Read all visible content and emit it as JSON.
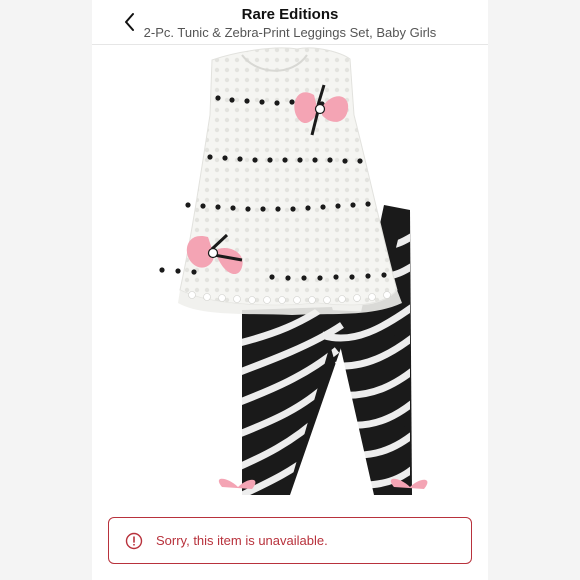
{
  "header": {
    "title": "Rare Editions",
    "subtitle": "2-Pc. Tunic & Zebra-Print Leggings Set, Baby Girls",
    "back_icon": "chevron-left-icon"
  },
  "product": {
    "image": "product-photo"
  },
  "alert": {
    "message": "Sorry, this item is unavailable.",
    "icon": "alert-circle-icon",
    "color": "#b8323c"
  }
}
